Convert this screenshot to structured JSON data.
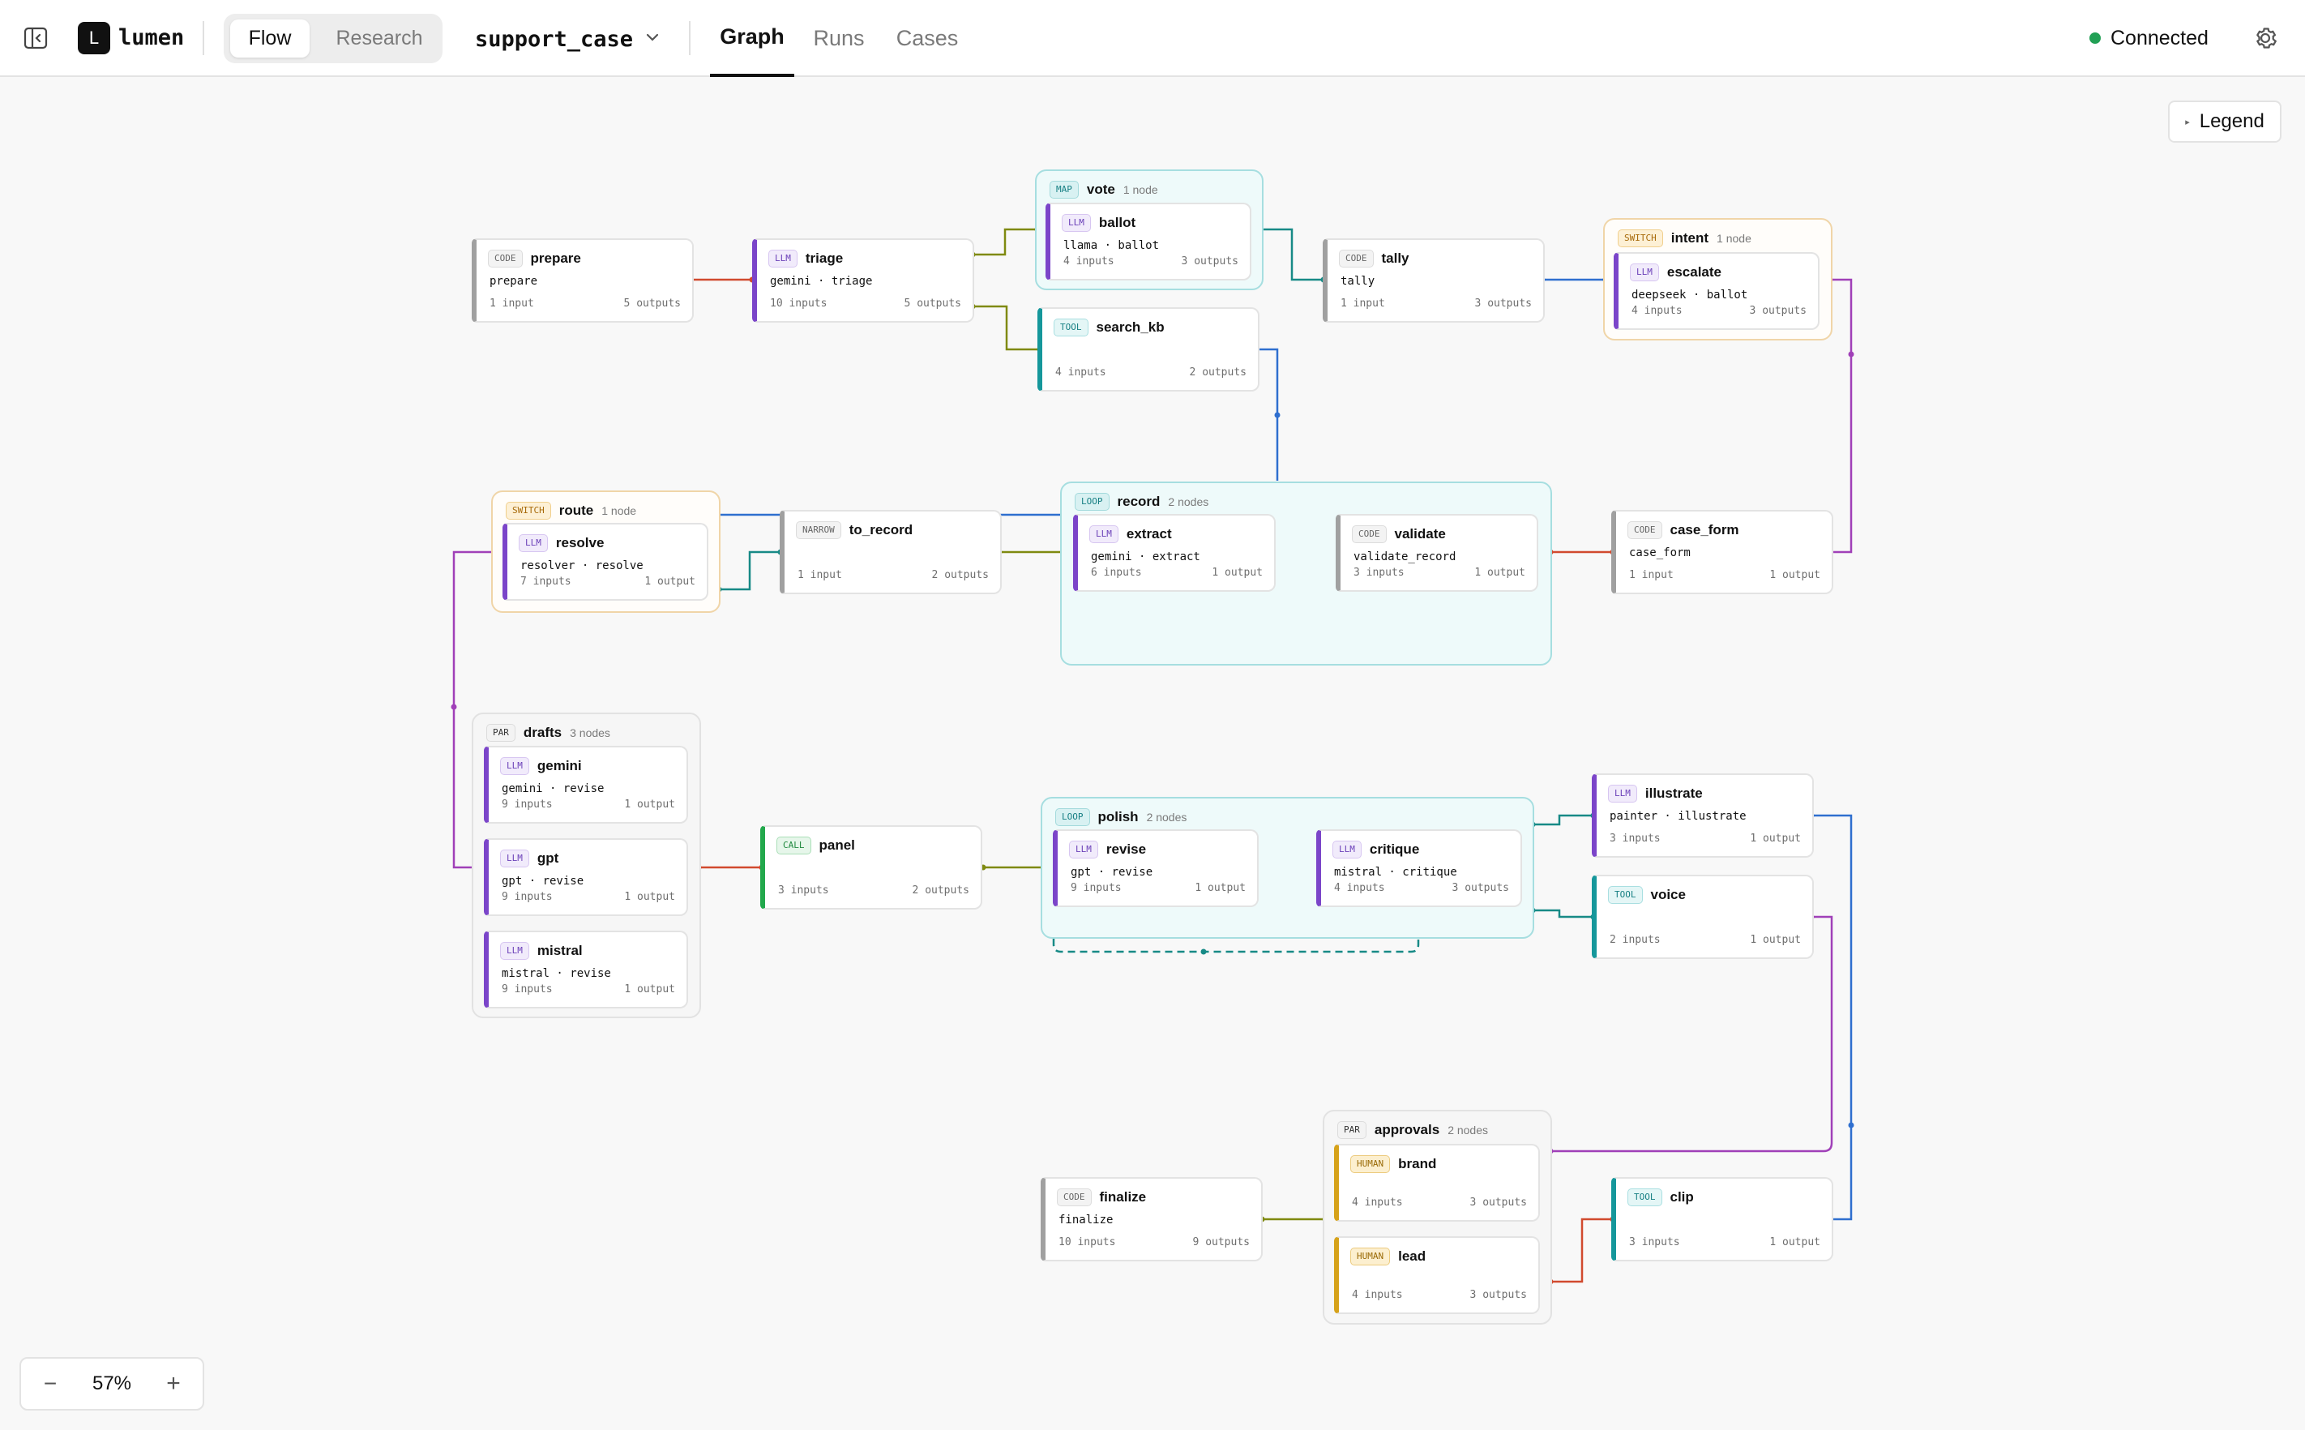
{
  "app": {
    "logo_letter": "L",
    "name": "lumen"
  },
  "mode_tabs": [
    "Flow",
    "Research"
  ],
  "active_mode": "Flow",
  "workflow": "support_case",
  "view_tabs": [
    "Graph",
    "Runs",
    "Cases"
  ],
  "active_view": "Graph",
  "status": {
    "label": "Connected",
    "color": "#22a055"
  },
  "legend_label": "Legend",
  "zoom": {
    "value": "57%",
    "minus": "−",
    "plus": "+"
  },
  "colors": {
    "llm": "#7b45c9",
    "code": "#a0a0a0",
    "tool": "#15979b",
    "call": "#22a84c",
    "human": "#d6a21a",
    "edge_red": "#d14a2e",
    "edge_olive": "#7f8a10",
    "edge_teal": "#178a86",
    "edge_blue": "#2f6fcf",
    "edge_purple": "#a040b8"
  },
  "groups": {
    "vote": {
      "type": "MAP",
      "name": "vote",
      "count": "1 node"
    },
    "intent": {
      "type": "SWITCH",
      "name": "intent",
      "count": "1 node"
    },
    "route": {
      "type": "SWITCH",
      "name": "route",
      "count": "1 node"
    },
    "record": {
      "type": "LOOP",
      "name": "record",
      "count": "2 nodes"
    },
    "drafts": {
      "type": "PAR",
      "name": "drafts",
      "count": "3 nodes"
    },
    "polish": {
      "type": "LOOP",
      "name": "polish",
      "count": "2 nodes"
    },
    "approvals": {
      "type": "PAR",
      "name": "approvals",
      "count": "2 nodes"
    }
  },
  "nodes": {
    "prepare": {
      "type": "CODE",
      "name": "prepare",
      "sub": "prepare",
      "inputs": "1 input",
      "outputs": "5 outputs"
    },
    "triage": {
      "type": "LLM",
      "name": "triage",
      "sub": "gemini · triage",
      "inputs": "10 inputs",
      "outputs": "5 outputs"
    },
    "ballot": {
      "type": "LLM",
      "name": "ballot",
      "sub": "llama · ballot",
      "inputs": "4 inputs",
      "outputs": "3 outputs"
    },
    "search_kb": {
      "type": "TOOL",
      "name": "search_kb",
      "sub": "",
      "inputs": "4 inputs",
      "outputs": "2 outputs"
    },
    "tally": {
      "type": "CODE",
      "name": "tally",
      "sub": "tally",
      "inputs": "1 input",
      "outputs": "3 outputs"
    },
    "escalate": {
      "type": "LLM",
      "name": "escalate",
      "sub": "deepseek · ballot",
      "inputs": "4 inputs",
      "outputs": "3 outputs"
    },
    "resolve": {
      "type": "LLM",
      "name": "resolve",
      "sub": "resolver · resolve",
      "inputs": "7 inputs",
      "outputs": "1 output"
    },
    "to_record": {
      "type": "NARROW",
      "name": "to_record",
      "sub": "",
      "inputs": "1 input",
      "outputs": "2 outputs"
    },
    "extract": {
      "type": "LLM",
      "name": "extract",
      "sub": "gemini · extract",
      "inputs": "6 inputs",
      "outputs": "1 output"
    },
    "validate": {
      "type": "CODE",
      "name": "validate",
      "sub": "validate_record",
      "inputs": "3 inputs",
      "outputs": "1 output"
    },
    "case_form": {
      "type": "CODE",
      "name": "case_form",
      "sub": "case_form",
      "inputs": "1 input",
      "outputs": "1 output"
    },
    "gemini": {
      "type": "LLM",
      "name": "gemini",
      "sub": "gemini · revise",
      "inputs": "9 inputs",
      "outputs": "1 output"
    },
    "gpt": {
      "type": "LLM",
      "name": "gpt",
      "sub": "gpt · revise",
      "inputs": "9 inputs",
      "outputs": "1 output"
    },
    "mistral": {
      "type": "LLM",
      "name": "mistral",
      "sub": "mistral · revise",
      "inputs": "9 inputs",
      "outputs": "1 output"
    },
    "panel": {
      "type": "CALL",
      "name": "panel",
      "sub": "",
      "inputs": "3 inputs",
      "outputs": "2 outputs"
    },
    "revise": {
      "type": "LLM",
      "name": "revise",
      "sub": "gpt · revise",
      "inputs": "9 inputs",
      "outputs": "1 output"
    },
    "critique": {
      "type": "LLM",
      "name": "critique",
      "sub": "mistral · critique",
      "inputs": "4 inputs",
      "outputs": "3 outputs"
    },
    "illustrate": {
      "type": "LLM",
      "name": "illustrate",
      "sub": "painter · illustrate",
      "inputs": "3 inputs",
      "outputs": "1 output"
    },
    "voice": {
      "type": "TOOL",
      "name": "voice",
      "sub": "",
      "inputs": "2 inputs",
      "outputs": "1 output"
    },
    "finalize": {
      "type": "CODE",
      "name": "finalize",
      "sub": "finalize",
      "inputs": "10 inputs",
      "outputs": "9 outputs"
    },
    "brand": {
      "type": "HUMAN",
      "name": "brand",
      "sub": "",
      "inputs": "4 inputs",
      "outputs": "3 outputs"
    },
    "lead": {
      "type": "HUMAN",
      "name": "lead",
      "sub": "",
      "inputs": "4 inputs",
      "outputs": "3 outputs"
    },
    "clip": {
      "type": "TOOL",
      "name": "clip",
      "sub": "",
      "inputs": "3 inputs",
      "outputs": "1 output"
    }
  }
}
